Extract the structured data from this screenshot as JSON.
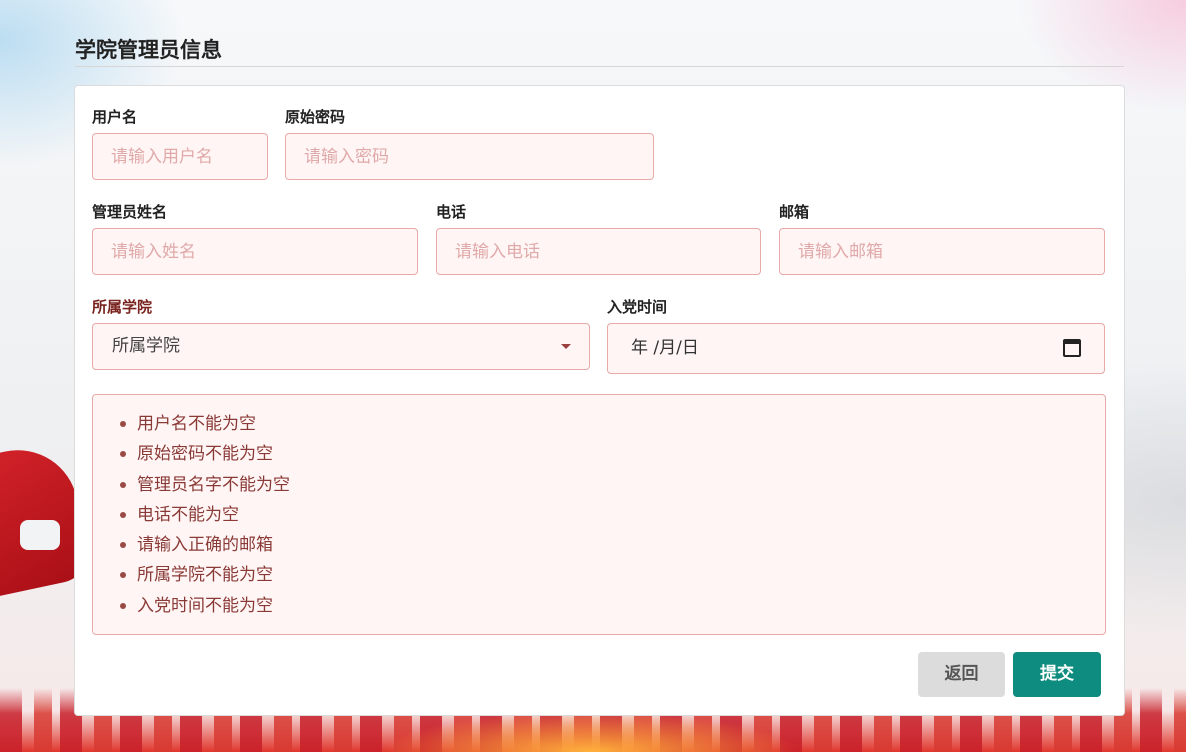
{
  "page": {
    "title": "学院管理员信息"
  },
  "form": {
    "username": {
      "label": "用户名",
      "placeholder": "请输入用户名"
    },
    "password": {
      "label": "原始密码",
      "placeholder": "请输入密码"
    },
    "name": {
      "label": "管理员姓名",
      "placeholder": "请输入姓名"
    },
    "phone": {
      "label": "电话",
      "placeholder": "请输入电话"
    },
    "email": {
      "label": "邮箱",
      "placeholder": "请输入邮箱"
    },
    "college": {
      "label": "所属学院",
      "selected": "所属学院"
    },
    "join_date": {
      "label": "入党时间",
      "value": "年 /月/日"
    }
  },
  "errors": [
    "用户名不能为空",
    "原始密码不能为空",
    "管理员名字不能为空",
    "电话不能为空",
    "请输入正确的邮箱",
    "所属学院不能为空",
    "入党时间不能为空"
  ],
  "actions": {
    "back": "返回",
    "submit": "提交"
  },
  "colors": {
    "error_border": "#e8a9a9",
    "error_bg": "#fff5f5",
    "error_text": "#8a3a36",
    "submit": "#0f8c80",
    "back": "#dcdcdc"
  }
}
